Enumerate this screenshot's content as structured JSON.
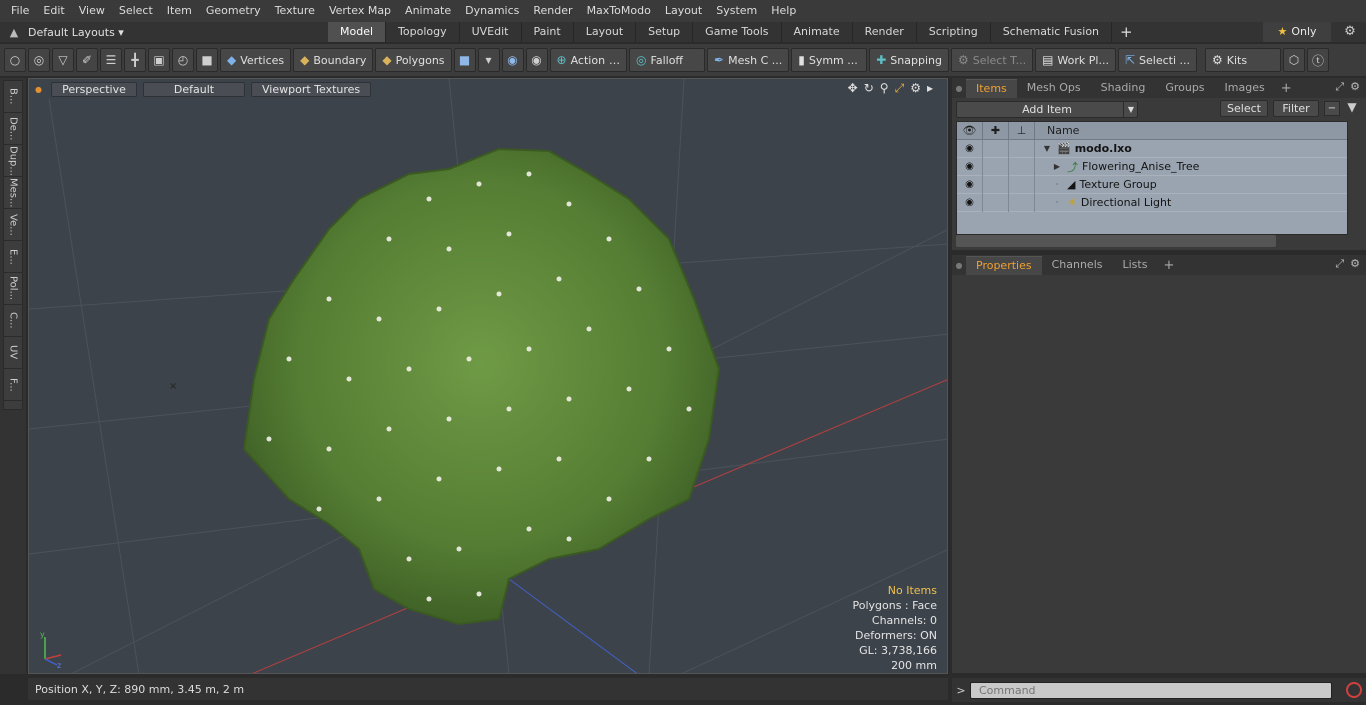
{
  "menu": [
    "File",
    "Edit",
    "View",
    "Select",
    "Item",
    "Geometry",
    "Texture",
    "Vertex Map",
    "Animate",
    "Dynamics",
    "Render",
    "MaxToModo",
    "Layout",
    "System",
    "Help"
  ],
  "layouts": {
    "label": "Default Layouts ▾"
  },
  "tabs": [
    "Model",
    "Topology",
    "UVEdit",
    "Paint",
    "Layout",
    "Setup",
    "Game Tools",
    "Animate",
    "Render",
    "Scripting",
    "Schematic Fusion"
  ],
  "only_label": "Only",
  "toolbar": {
    "vertices": "Vertices",
    "boundary": "Boundary",
    "polygons": "Polygons",
    "action": "Action",
    "falloff": "Falloff",
    "mesh": "Mesh C ...",
    "symm": "Symm ...",
    "snapping": "Snapping",
    "select_t": "Select T...",
    "work_pl": "Work Pl...",
    "selecti": "Selecti ...",
    "kits": "Kits"
  },
  "left_tabs": [
    "B...",
    "De...",
    "Dup...",
    "Mes...",
    "Ve...",
    "E...",
    "Pol...",
    "C...",
    "UV",
    "F..."
  ],
  "viewport": {
    "perspective": "Perspective",
    "default": "Default",
    "textures": "Viewport Textures",
    "info": {
      "no_items": "No Items",
      "polygons": "Polygons : Face",
      "channels": "Channels: 0",
      "deformers": "Deformers: ON",
      "gl": "GL: 3,738,166",
      "scale": "200 mm"
    }
  },
  "status": {
    "position": "Position X, Y, Z:   890 mm, 3.45 m, 2 m"
  },
  "items_panel": {
    "tabs": [
      "Items",
      "Mesh Ops",
      "Shading",
      "Groups",
      "Images"
    ],
    "add_item": "Add Item",
    "select": "Select",
    "filter": "Filter",
    "col_name": "Name",
    "rows": [
      "modo.lxo",
      "Flowering_Anise_Tree",
      "Texture Group",
      "Directional Light"
    ]
  },
  "props_panel": {
    "tabs": [
      "Properties",
      "Channels",
      "Lists"
    ]
  },
  "command": {
    "placeholder": "Command"
  },
  "colors": {
    "accent": "#f0a030",
    "viewport_bg": "#3d434a",
    "foliage": "#5e8a3a"
  }
}
